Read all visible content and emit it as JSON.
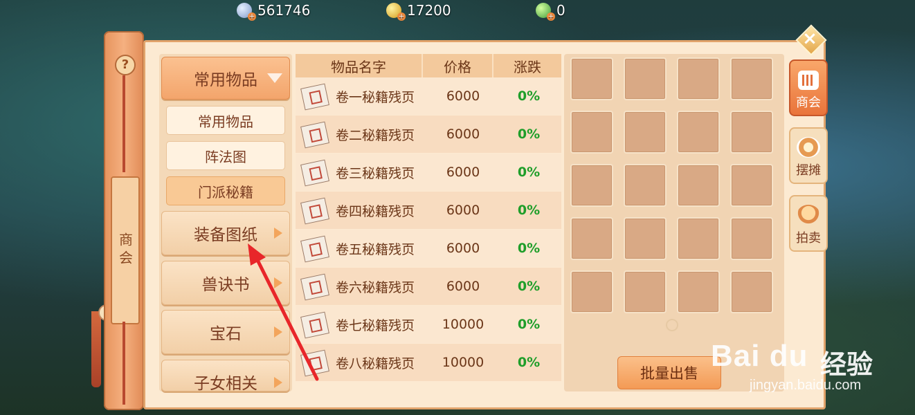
{
  "currencies": [
    {
      "icon": "silver-coin-icon",
      "value": "561746"
    },
    {
      "icon": "gold-coin-icon",
      "value": "17200"
    },
    {
      "icon": "jade-coin-icon",
      "value": "0"
    }
  ],
  "side_scroll": {
    "help": "?",
    "label": "商会"
  },
  "categories": {
    "active": "常用物品",
    "sub": [
      "常用物品",
      "阵法图",
      "门派秘籍"
    ],
    "sub_active_index": 2,
    "others": [
      "装备图纸",
      "兽诀书",
      "宝石",
      "子女相关"
    ]
  },
  "table": {
    "headers": [
      "物品名字",
      "价格",
      "涨跌"
    ],
    "rows": [
      {
        "name": "卷一秘籍残页",
        "price": "6000",
        "change": "0%"
      },
      {
        "name": "卷二秘籍残页",
        "price": "6000",
        "change": "0%"
      },
      {
        "name": "卷三秘籍残页",
        "price": "6000",
        "change": "0%"
      },
      {
        "name": "卷四秘籍残页",
        "price": "6000",
        "change": "0%"
      },
      {
        "name": "卷五秘籍残页",
        "price": "6000",
        "change": "0%"
      },
      {
        "name": "卷六秘籍残页",
        "price": "6000",
        "change": "0%"
      },
      {
        "name": "卷七秘籍残页",
        "price": "10000",
        "change": "0%"
      },
      {
        "name": "卷八秘籍残页",
        "price": "10000",
        "change": "0%"
      }
    ]
  },
  "bulk_sell": "批量出售",
  "right_tabs": [
    {
      "label": "商会",
      "icon": "shop-icon",
      "active": true
    },
    {
      "label": "摆摊",
      "icon": "stall-icon",
      "active": false
    },
    {
      "label": "拍卖",
      "icon": "auction-icon",
      "active": false
    }
  ],
  "watermark": {
    "logo": "Bai du",
    "cn": "经验",
    "url": "jingyan.baidu.com"
  },
  "colors": {
    "accent": "#f3a56c",
    "positive": "#1f9e2a",
    "panel": "#fcead2"
  }
}
